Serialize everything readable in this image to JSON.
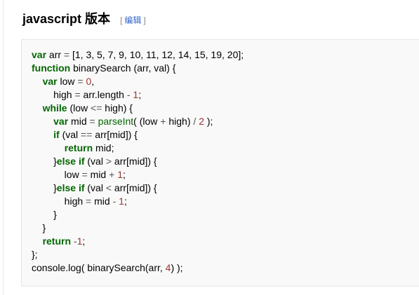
{
  "section": {
    "title": "javascript 版本",
    "edit_open": "[",
    "edit_label": "编辑",
    "edit_close": "]"
  },
  "colors": {
    "keyword": "#006600",
    "number": "#993333",
    "operator": "#555555",
    "text": "#000000",
    "code_background": "#f9f9f9",
    "link": "#3366cc"
  },
  "code_lines": [
    [
      [
        "kw",
        "var"
      ],
      [
        "id",
        " arr "
      ],
      [
        "op",
        "="
      ],
      [
        "id",
        " [1, 3, 5, 7, 9, 10, 11, 12, 14, 15, 19, 20];"
      ]
    ],
    [
      [
        "kw",
        "function"
      ],
      [
        "id",
        " binarySearch (arr, val) {"
      ]
    ],
    [
      [
        "id",
        "    "
      ],
      [
        "kw",
        "var"
      ],
      [
        "id",
        " low "
      ],
      [
        "op",
        "="
      ],
      [
        "id",
        " "
      ],
      [
        "num",
        "0"
      ],
      [
        "id",
        ","
      ]
    ],
    [
      [
        "id",
        "        high "
      ],
      [
        "op",
        "="
      ],
      [
        "id",
        " arr.length "
      ],
      [
        "op",
        "-"
      ],
      [
        "id",
        " "
      ],
      [
        "num",
        "1"
      ],
      [
        "id",
        ";"
      ]
    ],
    [
      [
        "id",
        "    "
      ],
      [
        "kw",
        "while"
      ],
      [
        "id",
        " (low "
      ],
      [
        "op",
        "<="
      ],
      [
        "id",
        " high) {"
      ]
    ],
    [
      [
        "id",
        "        "
      ],
      [
        "kw",
        "var"
      ],
      [
        "id",
        " mid "
      ],
      [
        "op",
        "="
      ],
      [
        "id",
        " "
      ],
      [
        "fn",
        "parseInt"
      ],
      [
        "id",
        "( (low "
      ],
      [
        "op",
        "+"
      ],
      [
        "id",
        " high) "
      ],
      [
        "op",
        "/"
      ],
      [
        "id",
        " "
      ],
      [
        "num",
        "2"
      ],
      [
        "id",
        " );"
      ]
    ],
    [
      [
        "id",
        "        "
      ],
      [
        "kw",
        "if"
      ],
      [
        "id",
        " (val "
      ],
      [
        "op",
        "=="
      ],
      [
        "id",
        " arr[mid]) {"
      ]
    ],
    [
      [
        "id",
        "            "
      ],
      [
        "kw",
        "return"
      ],
      [
        "id",
        " mid;"
      ]
    ],
    [
      [
        "id",
        "        }"
      ],
      [
        "kw",
        "else"
      ],
      [
        "id",
        " "
      ],
      [
        "kw",
        "if"
      ],
      [
        "id",
        " (val "
      ],
      [
        "op",
        ">"
      ],
      [
        "id",
        " arr[mid]) {"
      ]
    ],
    [
      [
        "id",
        "            low "
      ],
      [
        "op",
        "="
      ],
      [
        "id",
        " mid "
      ],
      [
        "op",
        "+"
      ],
      [
        "id",
        " "
      ],
      [
        "num",
        "1"
      ],
      [
        "id",
        ";"
      ]
    ],
    [
      [
        "id",
        "        }"
      ],
      [
        "kw",
        "else"
      ],
      [
        "id",
        " "
      ],
      [
        "kw",
        "if"
      ],
      [
        "id",
        " (val "
      ],
      [
        "op",
        "<"
      ],
      [
        "id",
        " arr[mid]) {"
      ]
    ],
    [
      [
        "id",
        "            high "
      ],
      [
        "op",
        "="
      ],
      [
        "id",
        " mid "
      ],
      [
        "op",
        "-"
      ],
      [
        "id",
        " "
      ],
      [
        "num",
        "1"
      ],
      [
        "id",
        ";"
      ]
    ],
    [
      [
        "id",
        "        }"
      ]
    ],
    [
      [
        "id",
        "    }"
      ]
    ],
    [
      [
        "id",
        "    "
      ],
      [
        "kw",
        "return"
      ],
      [
        "id",
        " "
      ],
      [
        "op",
        "-"
      ],
      [
        "num",
        "1"
      ],
      [
        "id",
        ";"
      ]
    ],
    [
      [
        "id",
        "};"
      ]
    ],
    [
      [
        "id",
        "console.log( binarySearch(arr, "
      ],
      [
        "num",
        "4"
      ],
      [
        "id",
        ") );"
      ]
    ]
  ]
}
